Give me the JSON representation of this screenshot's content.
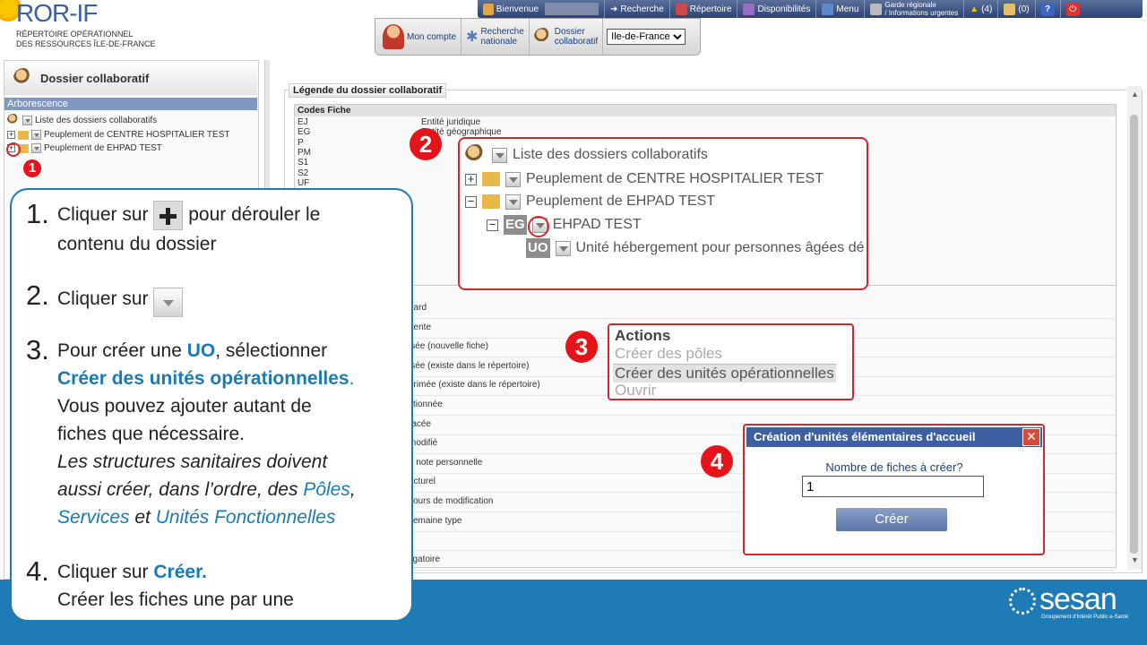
{
  "logo": {
    "title": "ROR-IF",
    "sub1": "RÉPERTOIRE OPÉRATIONNEL",
    "sub2": "DES RESSOURCES ÎLE-DE-FRANCE"
  },
  "toolbar": {
    "bienvenue": "Bienvenue",
    "recherche": "Recherche",
    "repertoire": "Répertoire",
    "disponibilites": "Disponibilités",
    "menu": "Menu",
    "garde1": "Garde régionale",
    "garde2": "/ Informations urgentes",
    "alerts": "(4)",
    "messages": "(0)",
    "help": "?",
    "power": "⏻"
  },
  "subnav": {
    "mon_compte": "Mon compte",
    "recherche_nat1": "Recherche",
    "recherche_nat2": "nationale",
    "dossier1": "Dossier",
    "dossier2": "collaboratif",
    "region": "Ile-de-France"
  },
  "left": {
    "title": "Dossier collaboratif",
    "arborescence": "Arborescence",
    "tree": [
      "Liste des dossiers collaboratifs",
      "Peuplement de CENTRE HOSPITALIER TEST",
      "Peuplement de EHPAD TEST"
    ]
  },
  "legend": {
    "title": "Légende du dossier collaboratif",
    "codes_head": "Codes Fiche",
    "codes": [
      "EJ",
      "EG",
      "P",
      "PM",
      "S1",
      "S2",
      "UF",
      "",
      "",
      "",
      "",
      "",
      "",
      ""
    ],
    "descs": [
      "Entité juridique",
      "Entité géographique",
      "",
      "",
      "",
      "",
      "",
      "",
      "",
      "",
      "",
      "",
      "",
      ""
    ],
    "statuses": [
      "dard",
      "ttente",
      "isée (nouvelle fiche)",
      "isée (existe dans le répertoire)",
      "orimée (existe dans le répertoire)",
      "ctionnée",
      "racée",
      "modifié",
      "e note personnelle",
      "ucturel",
      "cours de modification",
      "semaine type",
      "",
      "ligatoire"
    ]
  },
  "callout2": {
    "root": "Liste des dossiers collaboratifs",
    "item1": "Peuplement de CENTRE HOSPITALIER TEST",
    "item2": "Peuplement de EHPAD TEST",
    "eg_tag": "EG",
    "eg_label": "EHPAD TEST",
    "uo_tag": "UO",
    "uo_label": "Unité hébergement pour personnes âgées dé"
  },
  "callout3": {
    "title": "Actions",
    "a1": "Créer des pôles",
    "a2": "Créer des unités opérationnelles",
    "a3": "Ouvrir"
  },
  "dialog": {
    "title": "Création d'unités élémentaires d'accueil",
    "close": "✕",
    "label": "Nombre de fiches à créer?",
    "value": "1",
    "button": "Créer"
  },
  "numbers": {
    "n1": "1",
    "n2": "2",
    "n3": "3",
    "n4": "4"
  },
  "instructions": {
    "s1_num": "1.",
    "s1_a": "Cliquer sur",
    "s1_b": "pour dérouler le",
    "s1_c": "contenu du dossier",
    "s2_num": "2.",
    "s2_a": "Cliquer sur",
    "s3_num": "3.",
    "s3_a": "Pour créer une ",
    "s3_uo": "UO",
    "s3_b": ", sélectionner",
    "s3_c": "Créer des unités opérationnelles",
    "s3_dot": ".",
    "s3_d": "Vous pouvez ajouter autant de",
    "s3_e": "fiches que nécessaire.",
    "s3_f": "Les structures sanitaires doivent",
    "s3_g": "aussi créer, dans l’ordre, des ",
    "s3_poles": "Pôles",
    "s3_comma": ",",
    "s3_services": "Services",
    "s3_et": " et ",
    "s3_uf": "Unités Fonctionnelles",
    "s4_num": "4.",
    "s4_a": "Cliquer sur ",
    "s4_creer": "Créer.",
    "s4_b": "Créer les fiches une par une"
  },
  "footer": {
    "brand": "sesan",
    "sub": "Groupement d'Intérêt Public e-Santé"
  },
  "colors": {
    "accent_blue": "#1a7ab5",
    "callout_red": "#d3272e",
    "header_navy": "#2d4373"
  }
}
